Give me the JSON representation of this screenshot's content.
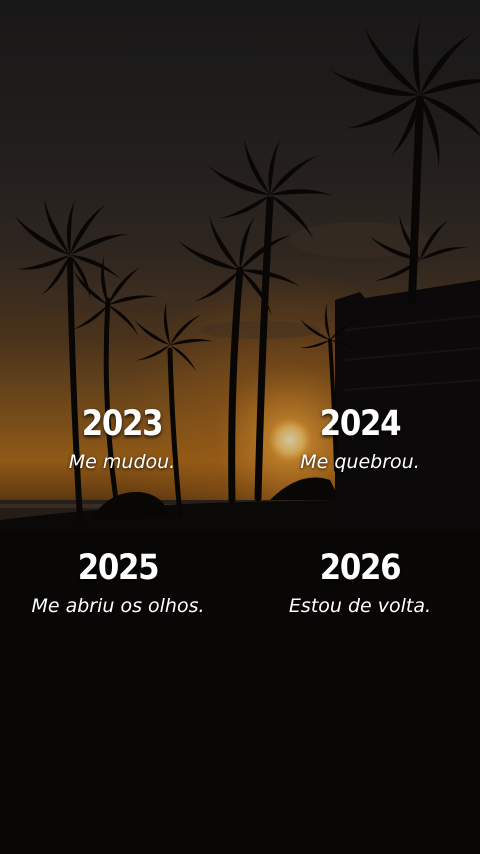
{
  "entries": [
    {
      "year": "2023",
      "caption": "Me mudou."
    },
    {
      "year": "2024",
      "caption": "Me quebrou."
    },
    {
      "year": "2025",
      "caption": "Me abriu os olhos."
    },
    {
      "year": "2026",
      "caption": "Estou de volta."
    }
  ],
  "colors": {
    "sky_top": "#22201f",
    "sky_glow": "#c2751c",
    "sun": "#ffe08a",
    "silhouette": "#0b0907",
    "text": "#ffffff"
  }
}
